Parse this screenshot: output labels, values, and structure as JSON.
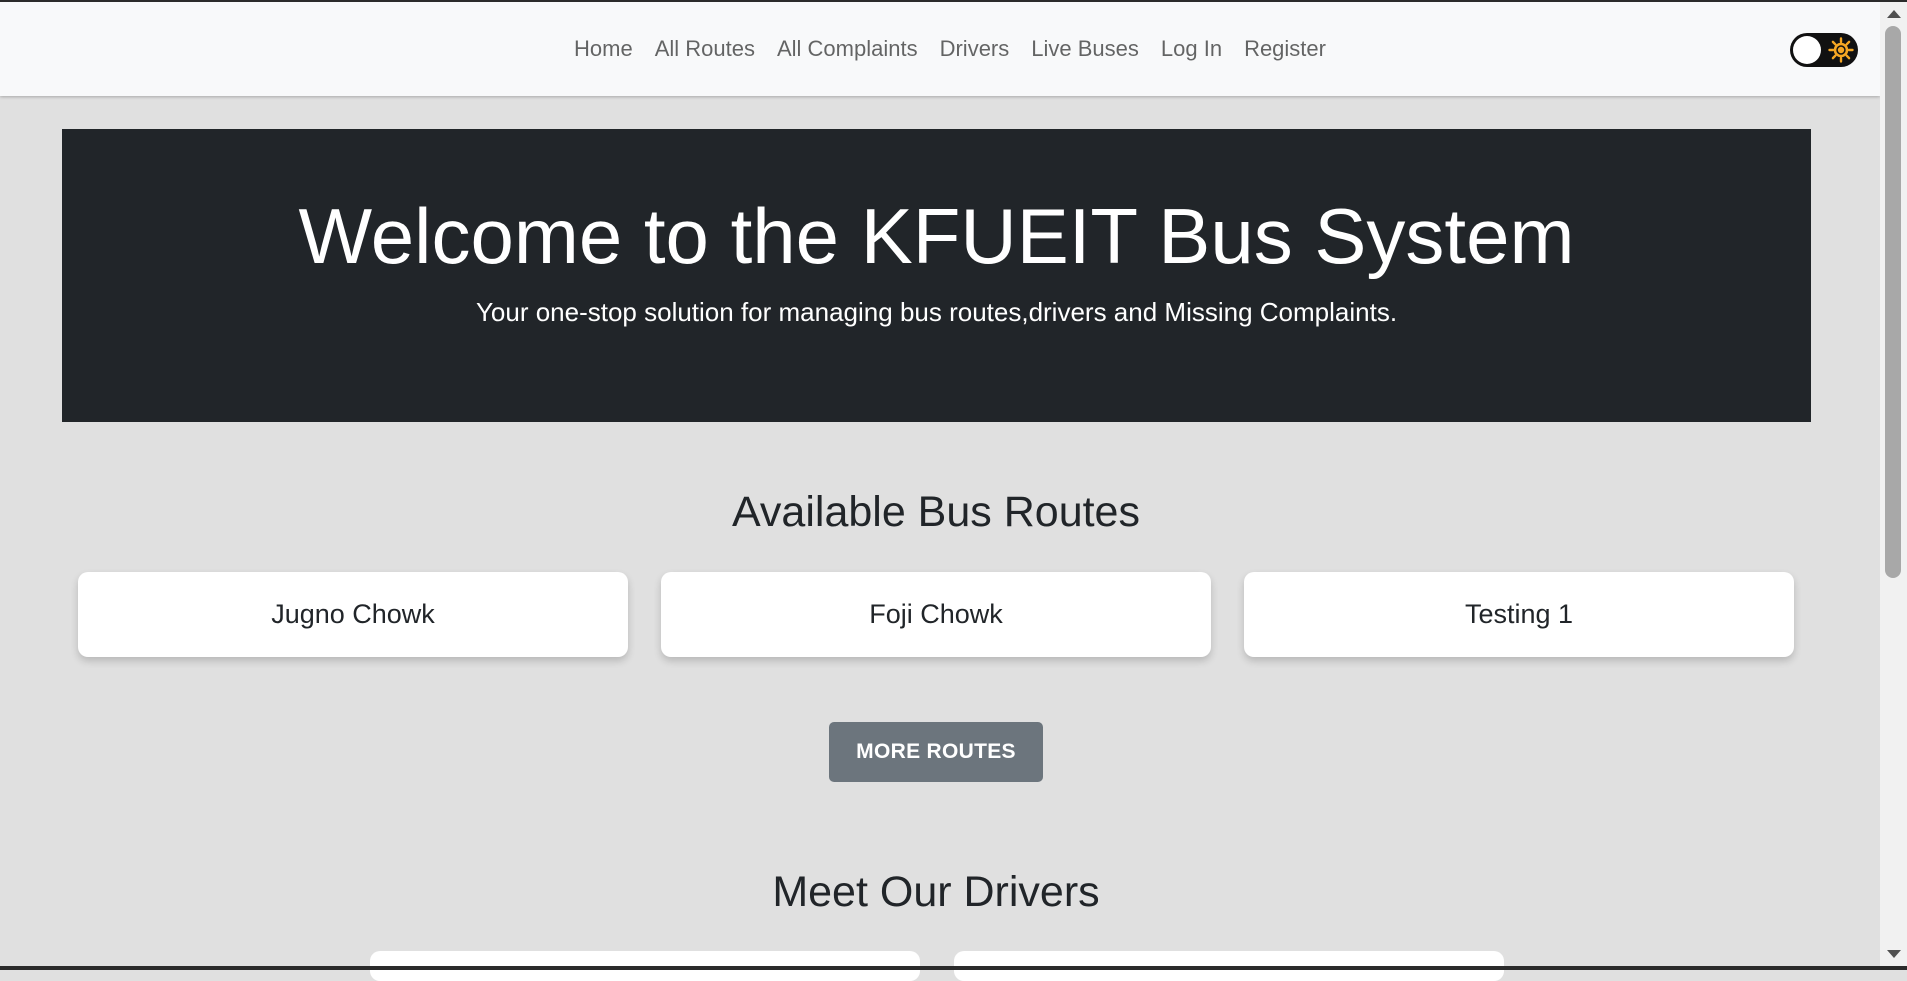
{
  "nav": {
    "links": [
      "Home",
      "All Routes",
      "All Complaints",
      "Drivers",
      "Live Buses",
      "Log In",
      "Register"
    ]
  },
  "theme_toggle": {
    "icon": "sun-icon",
    "state": "light"
  },
  "hero": {
    "title": "Welcome to the KFUEIT Bus System",
    "subtitle": "Your one-stop solution for managing bus routes,drivers and Missing Complaints."
  },
  "routes": {
    "heading": "Available Bus Routes",
    "items": [
      "Jugno Chowk",
      "Foji Chowk",
      "Testing 1"
    ],
    "more_button": "MORE ROUTES"
  },
  "drivers": {
    "heading": "Meet Our Drivers"
  },
  "colors": {
    "page_bg": "#e0e0e0",
    "hero_bg": "#212529",
    "button_bg": "#6c757d",
    "sun": "#f5a623"
  }
}
